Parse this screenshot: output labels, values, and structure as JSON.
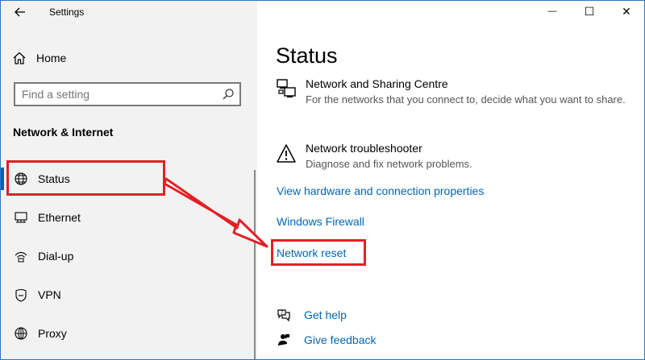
{
  "window": {
    "title": "Settings",
    "controls": {
      "minimize": "—",
      "maximize": "☐",
      "close": "✕"
    }
  },
  "sidebar": {
    "home_label": "Home",
    "search_placeholder": "Find a setting",
    "section_title": "Network & Internet",
    "items": [
      {
        "label": "Status",
        "icon": "globe-icon",
        "selected": true
      },
      {
        "label": "Ethernet",
        "icon": "ethernet-icon"
      },
      {
        "label": "Dial-up",
        "icon": "dialup-icon"
      },
      {
        "label": "VPN",
        "icon": "vpn-icon"
      },
      {
        "label": "Proxy",
        "icon": "proxy-icon"
      }
    ]
  },
  "main": {
    "title": "Status",
    "items": [
      {
        "title": "Network and Sharing Centre",
        "description": "For the networks that you connect to, decide what you want to share.",
        "icon": "network-sharing-icon"
      },
      {
        "title": "Network troubleshooter",
        "description": "Diagnose and fix network problems.",
        "icon": "warning-icon"
      }
    ],
    "links": [
      "View hardware and connection properties",
      "Windows Firewall",
      "Network reset"
    ],
    "help": {
      "get_help": "Get help",
      "give_feedback": "Give feedback"
    }
  },
  "colors": {
    "accent": "#0063b1",
    "link": "#0066b4",
    "annotation": "#e22025",
    "sidebar_bg": "#f2f2f2"
  }
}
